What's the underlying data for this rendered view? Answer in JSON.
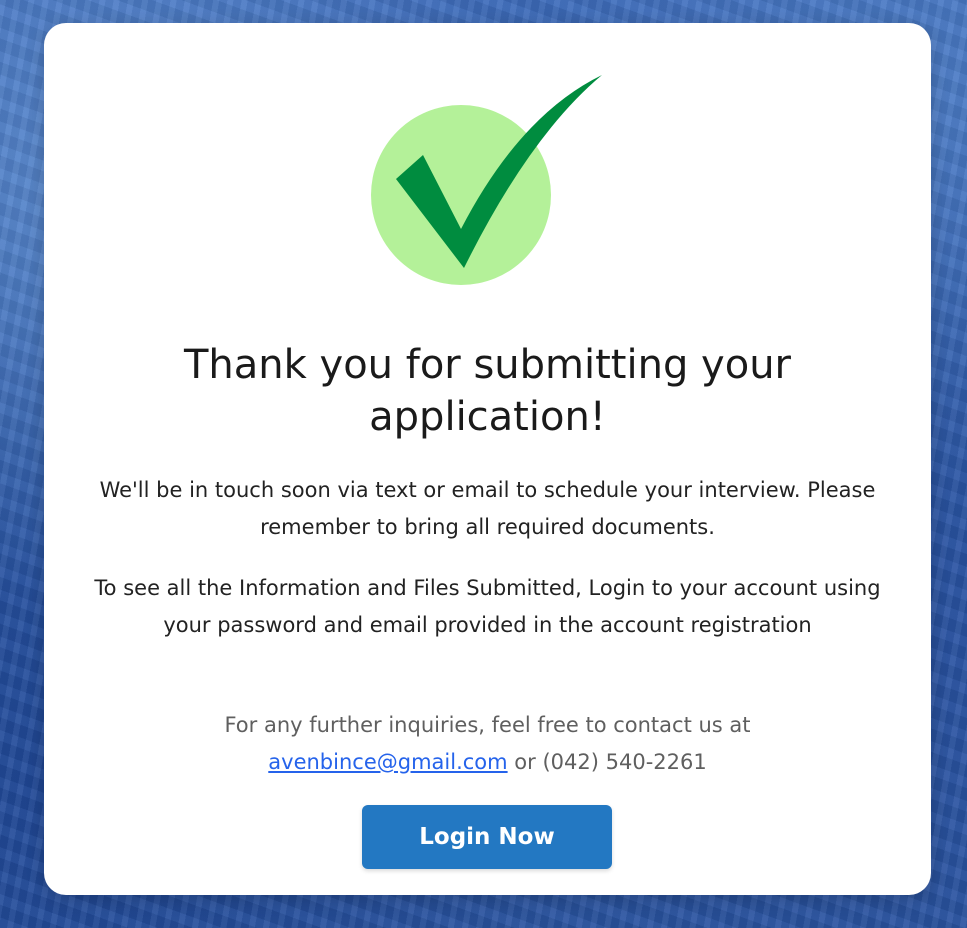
{
  "success_card": {
    "icon": "checkmark-icon",
    "colors": {
      "circle": "#b4f199",
      "check": "#008c3f",
      "button": "#2378c2",
      "link": "#2563eb"
    },
    "title": "Thank you for submitting your application!",
    "message_1": "We'll be in touch soon via text or email to schedule your interview. Please remember to bring all required documents.",
    "message_2": "To see all the Information and Files Submitted, Login to your account using your password and email provided in the account registration",
    "contact_prefix": "For any further inquiries, feel free to contact us at",
    "contact_email": "avenbince@gmail.com",
    "contact_joiner": "or",
    "contact_phone": "(042) 540-2261",
    "login_button": "Login Now"
  }
}
